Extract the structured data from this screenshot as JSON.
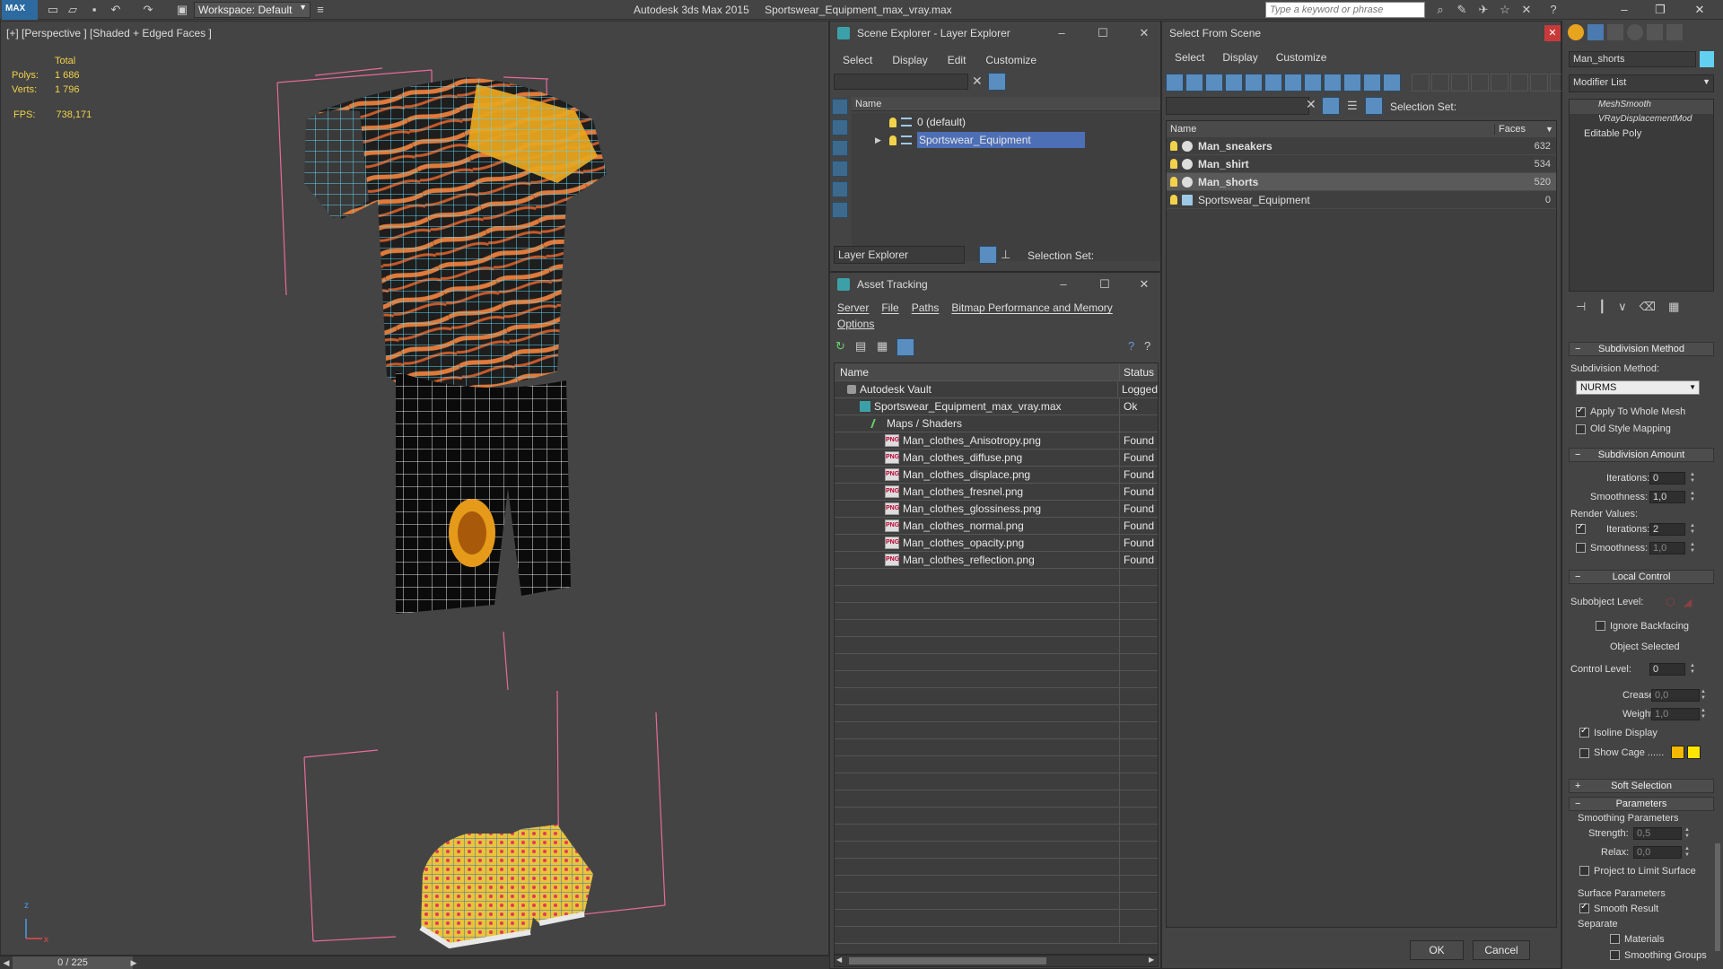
{
  "app": {
    "name": "Autodesk 3ds Max  2015",
    "file": "Sportswear_Equipment_max_vray.max",
    "logo_text": "MAX",
    "workspace_label": "Workspace: Default",
    "search_placeholder": "Type a keyword or phrase"
  },
  "viewport": {
    "label": "[+] [Perspective ] [Shaded + Edged Faces ]",
    "stats": {
      "total_label": "Total",
      "polys_label": "Polys:",
      "polys_value": "1 686",
      "verts_label": "Verts:",
      "verts_value": "1 796",
      "fps_label": "FPS:",
      "fps_value": "738,171"
    },
    "axis_x": "x",
    "axis_z": "z"
  },
  "timebar": {
    "counter": "0 / 225"
  },
  "scene_explorer": {
    "title": "Scene Explorer - Layer Explorer",
    "menu": [
      "Select",
      "Display",
      "Edit",
      "Customize"
    ],
    "column": "Name",
    "layers": [
      {
        "name": "0 (default)",
        "selected": false
      },
      {
        "name": "Sportswear_Equipment",
        "selected": true
      }
    ],
    "explorer_dropdown": "Layer Explorer",
    "selection_set_label": "Selection Set:"
  },
  "asset_tracking": {
    "title": "Asset Tracking",
    "menu": [
      "Server",
      "File",
      "Paths",
      "Bitmap Performance and Memory"
    ],
    "menu2": "Options",
    "col_name": "Name",
    "col_status": "Status",
    "rows": [
      {
        "name": "Autodesk Vault",
        "status": "Logged",
        "indent": 1,
        "type": "vault"
      },
      {
        "name": "Sportswear_Equipment_max_vray.max",
        "status": "Ok",
        "indent": 2,
        "type": "max"
      },
      {
        "name": "Maps / Shaders",
        "status": "",
        "indent": 3,
        "type": "folder"
      },
      {
        "name": "Man_clothes_Anisotropy.png",
        "status": "Found",
        "indent": 4,
        "type": "png"
      },
      {
        "name": "Man_clothes_diffuse.png",
        "status": "Found",
        "indent": 4,
        "type": "png"
      },
      {
        "name": "Man_clothes_displace.png",
        "status": "Found",
        "indent": 4,
        "type": "png"
      },
      {
        "name": "Man_clothes_fresnel.png",
        "status": "Found",
        "indent": 4,
        "type": "png"
      },
      {
        "name": "Man_clothes_glossiness.png",
        "status": "Found",
        "indent": 4,
        "type": "png"
      },
      {
        "name": "Man_clothes_normal.png",
        "status": "Found",
        "indent": 4,
        "type": "png"
      },
      {
        "name": "Man_clothes_opacity.png",
        "status": "Found",
        "indent": 4,
        "type": "png"
      },
      {
        "name": "Man_clothes_reflection.png",
        "status": "Found",
        "indent": 4,
        "type": "png"
      }
    ],
    "png_badge": "PNG"
  },
  "select_from_scene": {
    "title": "Select From Scene",
    "menu": [
      "Select",
      "Display",
      "Customize"
    ],
    "selection_set_label": "Selection Set:",
    "col_name": "Name",
    "col_faces": "Faces",
    "objects": [
      {
        "name": "Man_sneakers",
        "faces": "632",
        "bold": true,
        "highlight": false
      },
      {
        "name": "Man_shirt",
        "faces": "534",
        "bold": true,
        "highlight": false
      },
      {
        "name": "Man_shorts",
        "faces": "520",
        "bold": true,
        "highlight": true
      },
      {
        "name": "Sportswear_Equipment",
        "faces": "0",
        "bold": false,
        "highlight": false
      }
    ],
    "ok": "OK",
    "cancel": "Cancel"
  },
  "command_panel": {
    "object_name": "Man_shorts",
    "modifier_list": "Modifier List",
    "stack": [
      "MeshSmooth",
      "VRayDisplacementMod",
      "Editable Poly"
    ],
    "subdivision_method": {
      "title": "Subdivision Method",
      "method_label": "Subdivision Method:",
      "method_value": "NURMS",
      "apply_whole_mesh": "Apply To Whole Mesh",
      "old_style_mapping": "Old Style Mapping"
    },
    "subdivision_amount": {
      "title": "Subdivision Amount",
      "iterations_label": "Iterations:",
      "iterations_value": "0",
      "smoothness_label": "Smoothness:",
      "smoothness_value": "1,0",
      "render_values": "Render Values:",
      "r_iterations_label": "Iterations:",
      "r_iterations_value": "2",
      "r_smoothness_label": "Smoothness:",
      "r_smoothness_value": "1,0"
    },
    "local_control": {
      "title": "Local Control",
      "subobject_level": "Subobject Level:",
      "ignore_backfacing": "Ignore Backfacing",
      "object_selected": "Object Selected",
      "control_level_label": "Control Level:",
      "control_level_value": "0",
      "crease_label": "Crease:",
      "crease_value": "0,0",
      "weight_label": "Weight:",
      "weight_value": "1,0",
      "isoline_display": "Isoline Display",
      "show_cage": "Show Cage ......"
    },
    "soft_selection": {
      "title": "Soft Selection"
    },
    "parameters": {
      "title": "Parameters",
      "smoothing_params": "Smoothing Parameters",
      "strength_label": "Strength:",
      "strength_value": "0,5",
      "relax_label": "Relax:",
      "relax_value": "0,0",
      "project_limit": "Project to Limit Surface",
      "surface_params": "Surface Parameters",
      "smooth_result": "Smooth Result",
      "separate": "Separate",
      "materials": "Materials",
      "smoothing_groups": "Smoothing Groups"
    },
    "colors": {
      "cage1": "#f5b800",
      "cage2": "#ffe600"
    }
  }
}
